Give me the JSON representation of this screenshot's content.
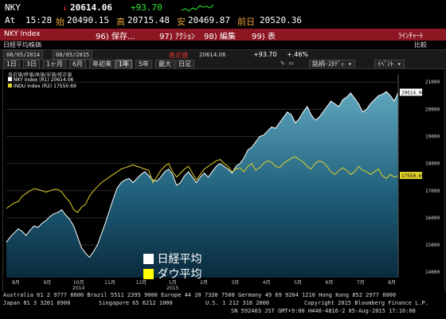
{
  "quote": {
    "ticker": "NKY",
    "arrow": "↓",
    "last": "20614.06",
    "change": "+93.70",
    "time_label": "At",
    "time": "15:28",
    "open_label": "始",
    "open": "20490.15",
    "high_label": "高",
    "high": "20715.48",
    "low_label": "安",
    "low": "20469.87",
    "prev_label": "前日",
    "prev": "20520.36"
  },
  "redbar": {
    "index_name": "NKY Index",
    "actions": [
      {
        "num": "96)",
        "label": "保存..."
      },
      {
        "num": "97)",
        "label": "ｱｸｼｮﾝ"
      },
      {
        "num": "98)",
        "label": "編集"
      },
      {
        "num": "99)",
        "label": "表"
      }
    ],
    "line_chart": "ﾗｲﾝﾁｬｰﾄ",
    "compare": "比較"
  },
  "tab": {
    "label": "日経平均株価"
  },
  "toolbar": {
    "date_from": "08/05/2014",
    "date_to": "08/05/2015",
    "latest_label": "直近値",
    "latest_value": "20614.06",
    "change": "+93.70",
    "change_pct": "+.46%",
    "periods": [
      "1日",
      "3日",
      "1ヶ月",
      "6月",
      "年初来",
      "1年",
      "5年",
      "最大",
      "日足"
    ],
    "active_period": "1年",
    "security_btn": "銘柄･ｽﾀﾃﾞｨ",
    "event_btn": "ｲﾍﾞﾝﾄ"
  },
  "chart_data": {
    "type": "line",
    "title": "",
    "panel_header": "直近値/終値/高値/安値/修正値",
    "legend_top": [
      {
        "name": "NKY Index (R1)",
        "value": "20614.06",
        "color": "#ffffff"
      },
      {
        "name": "INDU Index (R2)",
        "value": "17550.69",
        "color": "#e0d02a"
      }
    ],
    "x_labels": [
      "8月",
      "9月",
      "10月\n2014",
      "11月",
      "12月",
      "1月\n2015",
      "2月",
      "3月",
      "4月",
      "5月",
      "6月",
      "7月",
      "8月"
    ],
    "y_ticks": [
      14000,
      15000,
      16000,
      17000,
      18000,
      19000,
      20000,
      21000
    ],
    "ylim": [
      13800,
      21300
    ],
    "series": [
      {
        "name": "日経平均",
        "color": "#ffffff",
        "values": [
          15100,
          15300,
          15450,
          15600,
          15500,
          15350,
          15550,
          15700,
          15650,
          15800,
          15900,
          16050,
          16150,
          16200,
          16300,
          16100,
          15950,
          15700,
          15300,
          14900,
          14700,
          14550,
          14750,
          15000,
          15400,
          15800,
          16250,
          16700,
          17100,
          17300,
          17400,
          17450,
          17300,
          17450,
          17600,
          17700,
          17550,
          17400,
          17350,
          17500,
          17700,
          17800,
          17600,
          17200,
          17300,
          17550,
          17700,
          17500,
          17300,
          17500,
          17650,
          17500,
          17700,
          17900,
          18000,
          17900,
          17800,
          17650,
          17900,
          18000,
          18200,
          18500,
          18600,
          18800,
          19000,
          19050,
          19200,
          19350,
          19300,
          19500,
          19700,
          19900,
          19800,
          19500,
          19650,
          19900,
          20100,
          19800,
          19600,
          19700,
          19900,
          20100,
          20300,
          20200,
          20100,
          20350,
          20450,
          20600,
          20400,
          20200,
          19900,
          20000,
          20200,
          20350,
          20500,
          20550,
          20650,
          20500,
          20300,
          20614
        ]
      },
      {
        "name": "ダウ平均",
        "color": "#e0d02a",
        "values": [
          16350,
          16450,
          16550,
          16600,
          16800,
          16900,
          17000,
          17080,
          17050,
          17000,
          16950,
          17000,
          17050,
          17050,
          16950,
          16750,
          16600,
          16300,
          16200,
          16400,
          16500,
          16800,
          17000,
          17150,
          17300,
          17400,
          17500,
          17600,
          17700,
          17800,
          17850,
          17900,
          17950,
          17900,
          17850,
          17800,
          17750,
          17300,
          17500,
          17750,
          17900,
          18000,
          17700,
          17500,
          17650,
          17800,
          17900,
          17650,
          17400,
          17600,
          17800,
          17900,
          18000,
          18100,
          18150,
          18000,
          17900,
          17700,
          17800,
          17850,
          17700,
          17900,
          18000,
          17750,
          17850,
          18000,
          18100,
          18050,
          17900,
          17850,
          18000,
          18100,
          18200,
          18250,
          18150,
          18050,
          17900,
          17800,
          18000,
          18100,
          18050,
          17900,
          17700,
          17600,
          17750,
          17850,
          17750,
          17600,
          17700,
          17900,
          17750,
          17700,
          17600,
          17700,
          17800,
          17550,
          17450,
          17600,
          17500,
          17550
        ]
      }
    ],
    "legend_bottom": [
      {
        "name": "日経平均",
        "swatch": "#ffffff"
      },
      {
        "name": "ダウ平均",
        "swatch": "#ffff00"
      }
    ],
    "last_value_tags": [
      {
        "value": "20614.06",
        "bg": "#ffffff",
        "fg": "#000000"
      },
      {
        "value": "17550.69",
        "bg": "#e0d02a",
        "fg": "#000000"
      }
    ]
  },
  "footer": {
    "line1": "Australia 61 2 9777 8600 Brazil 5511 2395 9000 Europe 44 20 7330 7500 Germany 49 69 9204 1210 Hong Kong 852 2977 6000",
    "line2_left": "Japan 81 3 3201 8900",
    "line2_mid": "Singapore 65 6212 1000",
    "line2_us": "U.S. 1 212 318 2000",
    "line2_right": "Copyright 2015 Bloomberg Finance L.P.",
    "line3": "SN 592403 JST  GMT+9:00 H440-4816-2 05-Aug-2015 17:10:08"
  }
}
